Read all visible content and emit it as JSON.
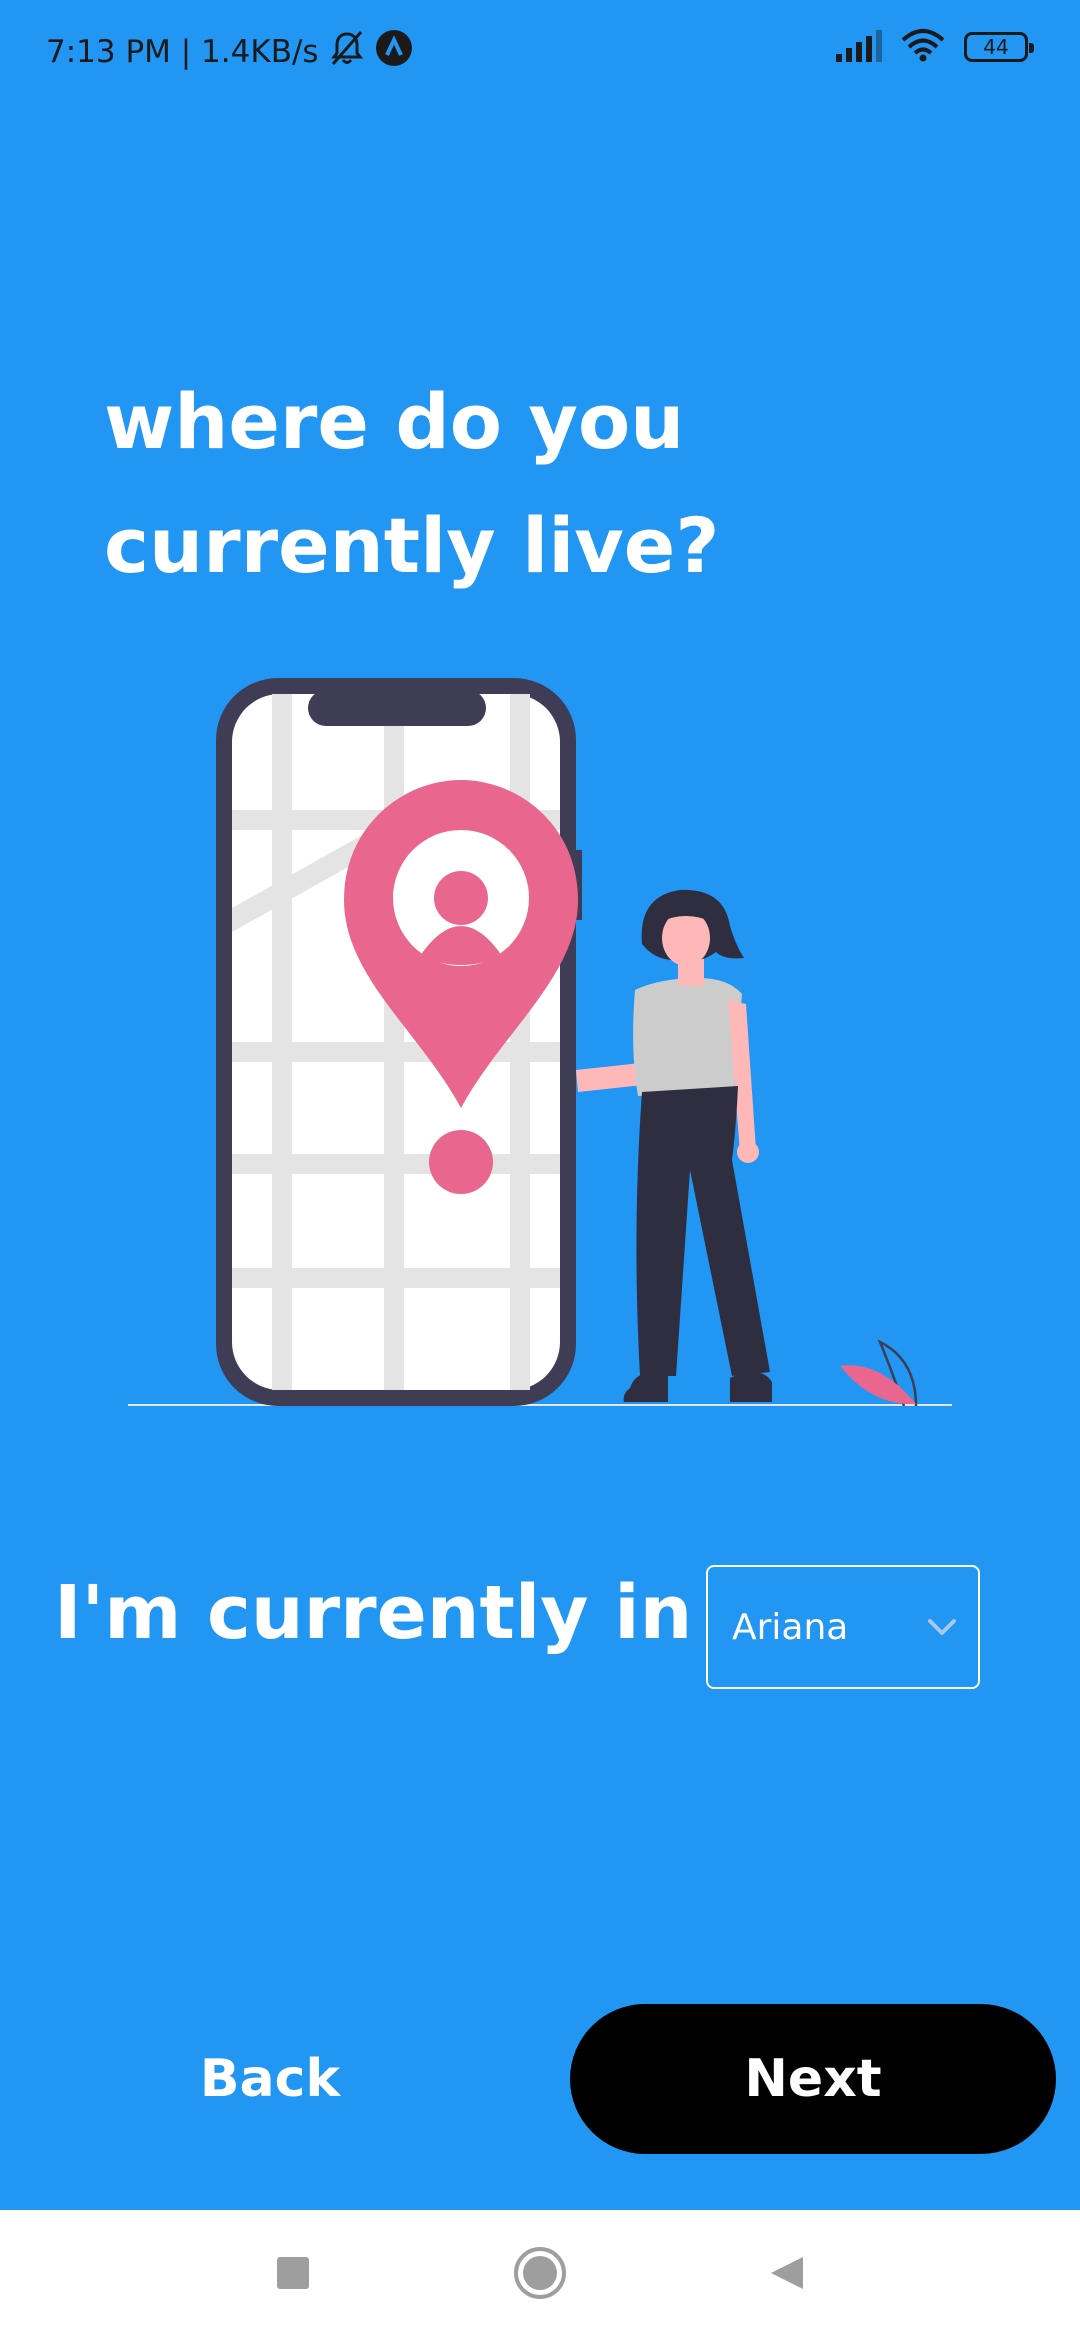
{
  "status_bar": {
    "time_speed": "7:13 PM | 1.4KB/s",
    "mute_icon": "bell-off-icon",
    "app_icon": "a-logo-icon",
    "signal_icon": "signal-icon",
    "wifi_icon": "wifi-icon",
    "battery_level": "44"
  },
  "question": {
    "title": "where do you currently live?"
  },
  "illustration": {
    "description_icon": "phone-map-location-illustration"
  },
  "location": {
    "label": "I'm currently in",
    "selected_country": "Ariana"
  },
  "actions": {
    "back_label": "Back",
    "next_label": "Next"
  },
  "nav_bar": {
    "recent_icon": "square-icon",
    "home_icon": "circle-icon",
    "back_icon": "triangle-back-icon"
  },
  "colors": {
    "background": "#2196F3",
    "pin": "#E9678E",
    "phone_frame": "#3F3D56",
    "next_button": "#000000"
  }
}
